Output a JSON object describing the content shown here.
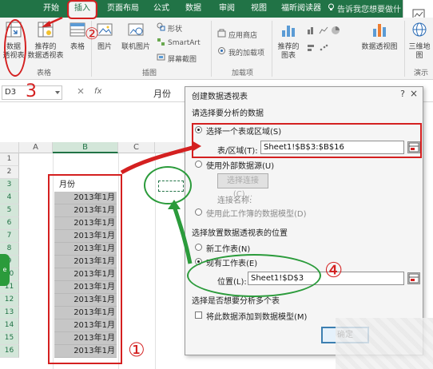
{
  "ribbon_tabs": [
    "开始",
    "插入",
    "页面布局",
    "公式",
    "数据",
    "审阅",
    "视图",
    "福昕阅读器"
  ],
  "tell_me": "告诉我您想要做什",
  "ribbon": {
    "pivot_table_line1": "数据",
    "pivot_table_line2": "透视表",
    "recommended_pivot_line1": "推荐的",
    "recommended_pivot_line2": "数据透视表",
    "table": "表格",
    "group_tables": "表格",
    "pictures": "图片",
    "online_pictures": "联机图片",
    "shapes": "形状",
    "smartart": "SmartArt",
    "screenshot": "屏幕截图",
    "group_illustrations": "插图",
    "store": "应用商店",
    "my_addins": "我的加载项",
    "group_addins": "加载项",
    "recommended_charts_line1": "推荐的",
    "recommended_charts_line2": "图表",
    "pivot_chart": "数据透视图",
    "map_3d_line1": "三维地",
    "map_3d_line2": "图",
    "group_demo": "演示"
  },
  "formula_bar": {
    "name_box": "D3",
    "fx": "fx",
    "content": "月份"
  },
  "columns": [
    "A",
    "B",
    "C"
  ],
  "rows": [
    "1",
    "2",
    "3",
    "4",
    "5",
    "6",
    "7",
    "8",
    "9",
    "10",
    "11",
    "12",
    "13",
    "14",
    "15",
    "16"
  ],
  "cells": {
    "header": "月份",
    "values": [
      "2013年1月",
      "2013年1月",
      "2013年1月",
      "2013年1月",
      "2013年1月",
      "2013年1月",
      "2013年1月",
      "2013年1月",
      "2013年1月",
      "2013年1月",
      "2013年1月",
      "2013年1月",
      "2013年1月"
    ]
  },
  "dialog": {
    "title": "创建数据透视表",
    "help": "?",
    "close": "×",
    "section_data": "请选择要分析的数据",
    "opt_range": "选择一个表或区域(S)",
    "range_label": "表/区域(T):",
    "range_value": "Sheet1!$B$3:$B$16",
    "opt_external": "使用外部数据源(U)",
    "choose_connection": "选择连接(C)...",
    "connection_name": "连接名称:",
    "opt_data_model": "使用此工作簿的数据模型(D)",
    "section_location": "选择放置数据透视表的位置",
    "opt_new_sheet": "新工作表(N)",
    "opt_existing_sheet": "现有工作表(E)",
    "location_label": "位置(L):",
    "location_value": "Sheet1!$D$3",
    "section_multi": "选择是否想要分析多个表",
    "add_to_model": "将此数据添加到数据模型(M)",
    "ok": "确定"
  },
  "annotations": [
    "①",
    "②",
    "3",
    "④"
  ],
  "colors": {
    "excel_green": "#217346",
    "annotation_red": "#d42020",
    "annotation_green": "#2b9b3b"
  }
}
